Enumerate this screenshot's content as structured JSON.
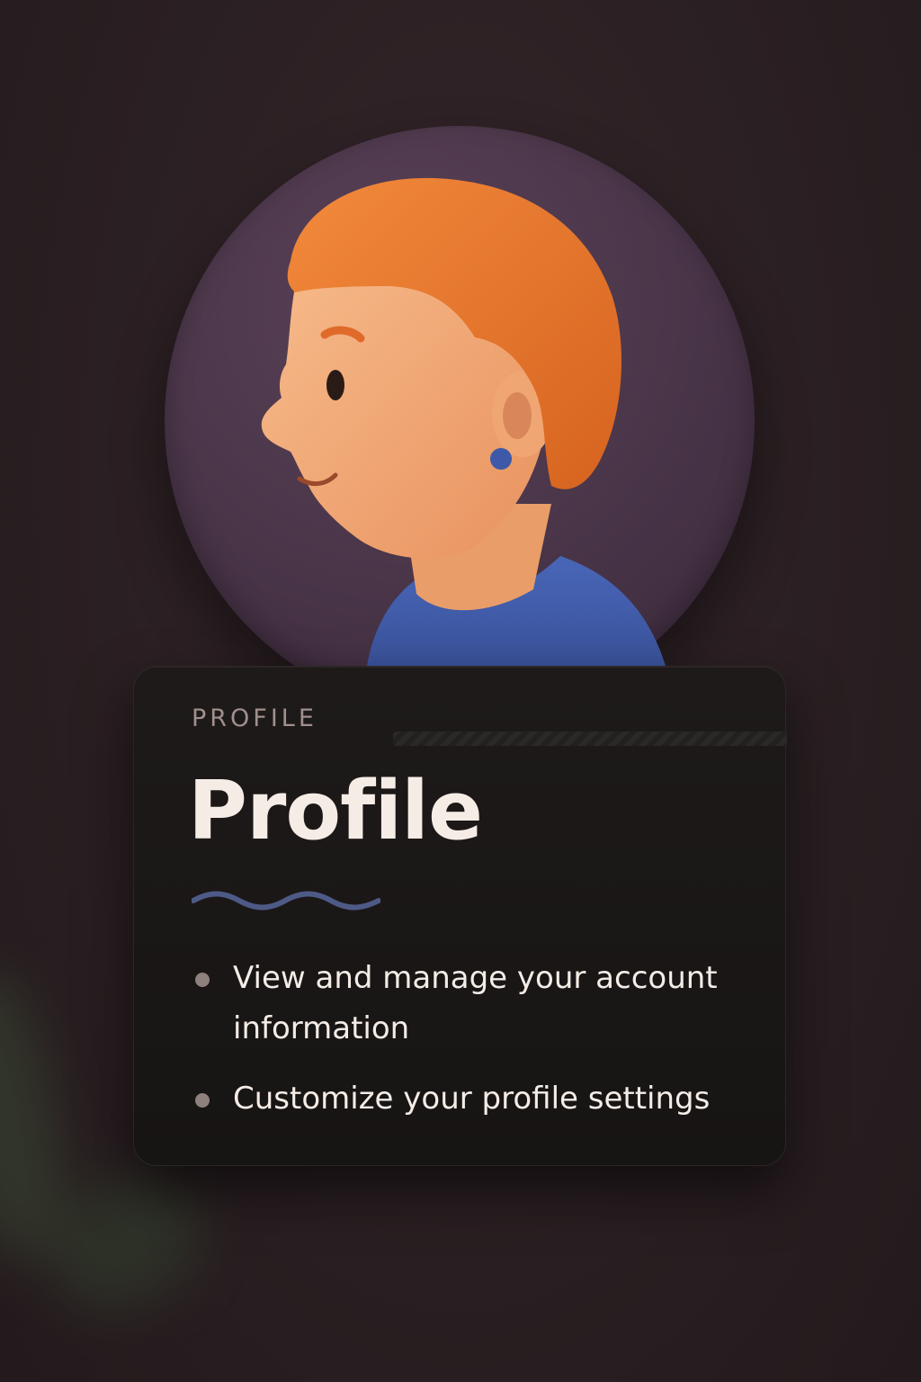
{
  "card": {
    "eyebrow": "PROFILE",
    "title": "Profile",
    "bullets": [
      "View and manage your account information",
      "Customize your profile settings"
    ]
  },
  "icons": {
    "avatar": "profile-avatar-illustration",
    "wave": "wave-divider-icon",
    "bullet": "bullet-dot-icon"
  },
  "colors": {
    "background": "#2a1f22",
    "card": "#1a1616",
    "disc": "#4a3549",
    "hair": "#e8732e",
    "skin": "#f4ab7a",
    "shirt": "#3f5aa6",
    "title": "#f6ece6",
    "wave": "#4e5a86"
  }
}
